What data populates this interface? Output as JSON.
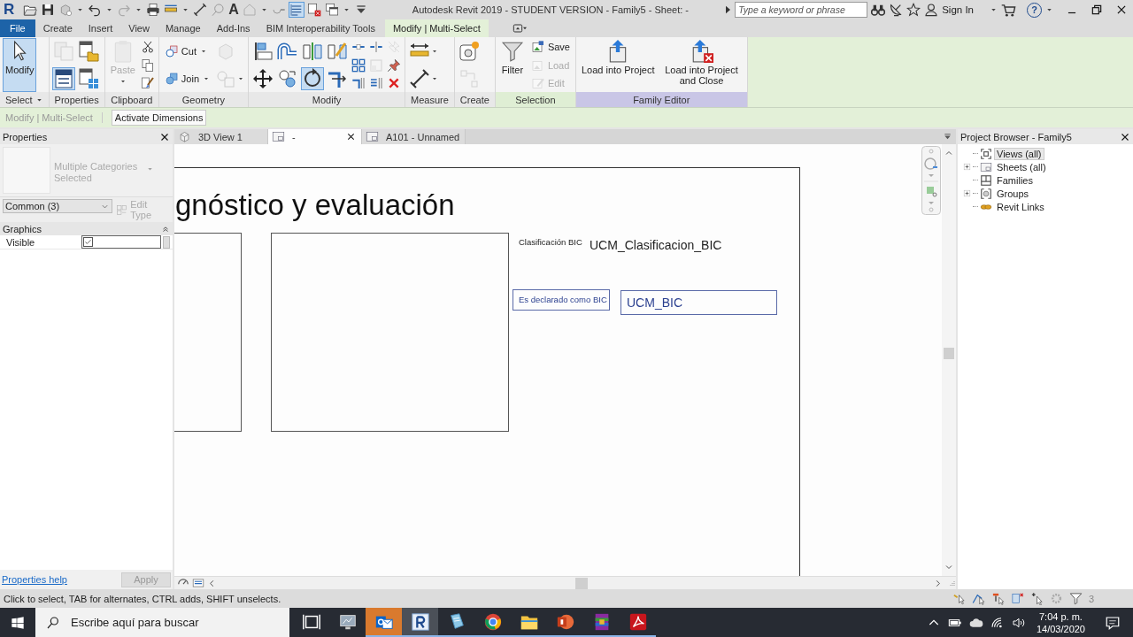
{
  "title_bar": {
    "app_logo": "R",
    "text_tool": "A",
    "title": "Autodesk Revit 2019 - STUDENT VERSION - Family5 - Sheet: -",
    "search": {
      "placeholder": "Type a keyword or phrase"
    },
    "sign_in": "Sign In",
    "help": "?"
  },
  "tabs": [
    {
      "label": "File",
      "kind": "application",
      "selected": false
    },
    {
      "label": "Create",
      "kind": "standard",
      "selected": false
    },
    {
      "label": "Insert",
      "kind": "standard",
      "selected": false
    },
    {
      "label": "View",
      "kind": "standard",
      "selected": false
    },
    {
      "label": "Manage",
      "kind": "standard",
      "selected": false
    },
    {
      "label": "Add-Ins",
      "kind": "standard",
      "selected": false
    },
    {
      "label": "BIM Interoperability Tools",
      "kind": "standard",
      "selected": false
    },
    {
      "label": "Modify | Multi-Select",
      "kind": "contextual",
      "selected": true
    }
  ],
  "ribbon": {
    "panels": [
      {
        "label": "Select",
        "menu": true,
        "color": "#e8e8e8",
        "columns": [
          [
            {
              "kind": "large",
              "label": "Modify",
              "selected": true,
              "disabled": false,
              "menu": false
            }
          ]
        ]
      },
      {
        "label": "Properties",
        "menu": false,
        "color": "#e8e8e8",
        "columns": [
          [
            {
              "kind": "icon",
              "selected": false,
              "disabled": true,
              "menu": false
            },
            {
              "kind": "icon",
              "selected": true,
              "disabled": false,
              "menu": false
            }
          ],
          [
            {
              "kind": "icon",
              "selected": false,
              "disabled": false,
              "menu": false
            },
            {
              "kind": "icon",
              "selected": false,
              "disabled": false,
              "menu": false
            }
          ]
        ]
      },
      {
        "label": "Clipboard",
        "menu": false,
        "color": "#e8e8e8",
        "columns": [
          [
            {
              "kind": "large",
              "label": "Paste",
              "selected": false,
              "disabled": true,
              "menu": true
            }
          ],
          [
            {
              "kind": "icon",
              "selected": false,
              "disabled": false,
              "menu": false
            },
            {
              "kind": "icon",
              "selected": false,
              "disabled": false,
              "menu": false
            },
            {
              "kind": "icon",
              "selected": false,
              "disabled": false,
              "menu": false
            }
          ]
        ]
      },
      {
        "label": "Geometry",
        "menu": false,
        "color": "#e8e8e8",
        "columns": [
          [
            {
              "kind": "small",
              "label": "Cut",
              "selected": false,
              "disabled": false,
              "menu": true
            },
            {
              "kind": "small",
              "label": "Join",
              "selected": false,
              "disabled": false,
              "menu": true
            }
          ],
          [
            {
              "kind": "icon",
              "selected": false,
              "disabled": true,
              "menu": false
            },
            {
              "kind": "icon",
              "selected": false,
              "disabled": true,
              "menu": true
            }
          ]
        ]
      },
      {
        "label": "Modify",
        "menu": false,
        "color": "#e8e8e8",
        "columns": [
          [
            {
              "kind": "icon",
              "selected": false,
              "disabled": false,
              "menu": false
            },
            {
              "kind": "icon",
              "selected": false,
              "disabled": false,
              "menu": false
            }
          ],
          [
            {
              "kind": "icon",
              "selected": false,
              "disabled": false,
              "menu": false
            },
            {
              "kind": "icon",
              "selected": false,
              "disabled": false,
              "menu": false
            }
          ],
          [
            {
              "kind": "icon",
              "selected": false,
              "disabled": false,
              "menu": false
            },
            {
              "kind": "icon",
              "selected": true,
              "disabled": false,
              "menu": false
            }
          ],
          [
            {
              "kind": "icon",
              "selected": false,
              "disabled": false,
              "menu": false
            },
            {
              "kind": "icon",
              "selected": false,
              "disabled": false,
              "menu": false
            }
          ],
          [
            {
              "kind": "icon",
              "selected": false,
              "disabled": false,
              "menu": false
            },
            {
              "kind": "icon",
              "selected": false,
              "disabled": false,
              "menu": false
            },
            {
              "kind": "icon",
              "selected": false,
              "disabled": false,
              "menu": false
            }
          ],
          [
            {
              "kind": "icon",
              "selected": false,
              "disabled": false,
              "menu": false
            },
            {
              "kind": "icon",
              "selected": false,
              "disabled": true,
              "menu": false
            },
            {
              "kind": "icon",
              "selected": false,
              "disabled": false,
              "menu": false
            }
          ],
          [
            {
              "kind": "icon",
              "selected": false,
              "disabled": true,
              "menu": false
            },
            {
              "kind": "icon",
              "selected": false,
              "disabled": false,
              "menu": false
            },
            {
              "kind": "icon",
              "selected": false,
              "disabled": false,
              "menu": false
            }
          ]
        ]
      },
      {
        "label": "Measure",
        "menu": false,
        "color": "#e8e8e8",
        "columns": [
          [
            {
              "kind": "icon",
              "selected": false,
              "disabled": false,
              "menu": true
            },
            {
              "kind": "icon",
              "selected": false,
              "disabled": false,
              "menu": true
            }
          ]
        ]
      },
      {
        "label": "Create",
        "menu": false,
        "color": "#e8e8e8",
        "columns": [
          [
            {
              "kind": "icon",
              "selected": false,
              "disabled": false,
              "menu": false
            },
            {
              "kind": "icon",
              "selected": false,
              "disabled": true,
              "menu": false
            }
          ]
        ]
      },
      {
        "label": "Selection",
        "menu": false,
        "color": "#dfeed4",
        "columns": [
          [
            {
              "kind": "large",
              "label": "Filter",
              "selected": false,
              "disabled": false,
              "menu": false
            }
          ],
          [
            {
              "kind": "small",
              "label": "Save",
              "selected": false,
              "disabled": false,
              "menu": false
            },
            {
              "kind": "small",
              "label": "Load",
              "selected": false,
              "disabled": true,
              "menu": false
            },
            {
              "kind": "small",
              "label": "Edit",
              "selected": false,
              "disabled": true,
              "menu": false
            }
          ]
        ]
      },
      {
        "label": "Family Editor",
        "menu": false,
        "color": "#c9c6e6",
        "columns": [
          [
            {
              "kind": "large",
              "label": "Load into Project",
              "selected": false,
              "disabled": false,
              "menu": false
            }
          ],
          [
            {
              "kind": "large",
              "label": "Load into Project and Close",
              "selected": false,
              "disabled": false,
              "menu": false
            }
          ]
        ]
      }
    ]
  },
  "options_bar": {
    "context": "Modify | Multi-Select",
    "button": "Activate Dimensions"
  },
  "properties": {
    "title": "Properties",
    "type_selector": "Multiple Categories Selected",
    "filter": "Common (3)",
    "edit_type": {
      "label": "Edit Type",
      "disabled": true
    },
    "groups": [
      {
        "label": "Graphics",
        "expanded": true,
        "rows": [
          {
            "name": "Visible",
            "checked": true
          }
        ]
      }
    ],
    "help_link": "Properties help",
    "apply": {
      "label": "Apply",
      "disabled": true
    }
  },
  "view_tabs": [
    {
      "label": "3D View 1",
      "kind": "model",
      "selected": false
    },
    {
      "label": "-",
      "kind": "sheet",
      "selected": true
    },
    {
      "label": "A101 - Unnamed",
      "kind": "sheet",
      "selected": false
    }
  ],
  "sheet": {
    "heading": "gnóstico y evaluación",
    "labels": [
      {
        "text": "Clasificación BIC",
        "kind": "label"
      },
      {
        "text": "UCM_Clasificacion_BIC",
        "kind": "value"
      },
      {
        "text": "Es declarado como BIC",
        "kind": "boxed-label"
      },
      {
        "text": "UCM_BIC",
        "kind": "boxed-value"
      }
    ]
  },
  "project_browser": {
    "title": "Project Browser - Family5",
    "items": [
      {
        "label": "Views (all)",
        "kind": "views",
        "expandable": false,
        "selected": true
      },
      {
        "label": "Sheets (all)",
        "kind": "sheets",
        "expandable": true,
        "selected": false
      },
      {
        "label": "Families",
        "kind": "families",
        "expandable": false,
        "selected": false
      },
      {
        "label": "Groups",
        "kind": "groups",
        "expandable": true,
        "selected": false
      },
      {
        "label": "Revit Links",
        "kind": "links",
        "expandable": false,
        "selected": false
      }
    ]
  },
  "status_bar": {
    "message": "Click to select, TAB for alternates, CTRL adds, SHIFT unselects.",
    "selection_count": "3"
  },
  "taskbar": {
    "search_placeholder": "Escribe aquí para buscar",
    "apps": [
      {
        "kind": "task-view",
        "running": false,
        "selected": false,
        "flashing": false
      },
      {
        "kind": "monitor",
        "running": false,
        "selected": false,
        "flashing": false
      },
      {
        "kind": "mail",
        "running": true,
        "selected": false,
        "flashing": true
      },
      {
        "kind": "revit",
        "running": true,
        "selected": true,
        "flashing": false
      },
      {
        "kind": "notepad",
        "running": true,
        "selected": false,
        "flashing": false
      },
      {
        "kind": "browser",
        "running": true,
        "selected": false,
        "flashing": false
      },
      {
        "kind": "folder",
        "running": true,
        "selected": false,
        "flashing": false
      },
      {
        "kind": "slides",
        "running": true,
        "selected": false,
        "flashing": false
      },
      {
        "kind": "archive",
        "running": true,
        "selected": false,
        "flashing": false
      },
      {
        "kind": "pdf",
        "running": true,
        "selected": false,
        "flashing": false
      }
    ],
    "time": "7:04 p. m.",
    "date": "14/03/2020"
  }
}
